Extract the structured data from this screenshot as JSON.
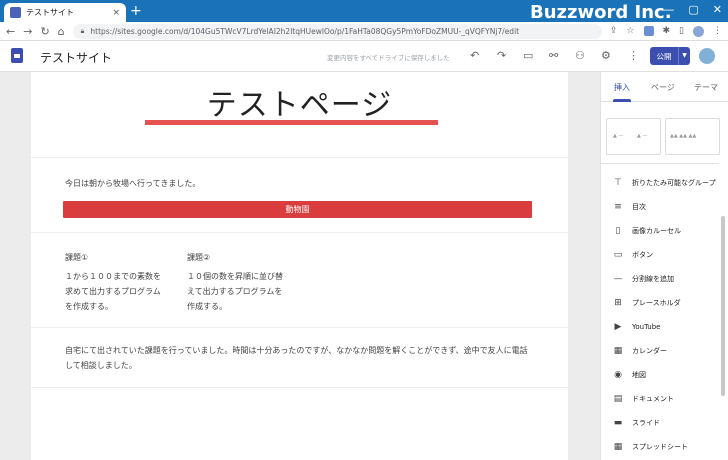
{
  "browser": {
    "tab_title": "テストサイト",
    "tab_close": "×",
    "new_tab": "+",
    "url": "https://sites.google.com/d/104Gu5TWcV7LrdYelAI2h2ltqHUewlOo/p/1FaHTa08QGy5PmYoFDoZMUU-_qVQFYNj7/edit",
    "window_controls": [
      "—",
      "▢",
      "✕"
    ]
  },
  "watermark": "Buzzword Inc.",
  "sites": {
    "site_title": "テストサイト",
    "save_status": "変更内容をすべてドライブに保存しました",
    "publish_label": "公開"
  },
  "page": {
    "title": "テストページ",
    "paragraph1": "今日は朝から牧場へ行ってきました。",
    "button_label": "動物園",
    "col1_heading": "課題①",
    "col1_body": "１から１００までの素数を求めて出力するプログラムを作成する。",
    "col2_heading": "課題②",
    "col2_body": "１０個の数を昇順に並び替えて出力するプログラムを作成する。",
    "paragraph2": "自宅にて出されていた課題を行っていました。時間は十分あったのですが、なかなか問題を解くことができず、途中で友人に電話して相談しました。"
  },
  "panel": {
    "tabs": [
      "挿入",
      "ページ",
      "テーマ"
    ],
    "active_tab": 0,
    "items": [
      {
        "icon": "collapsible-group-icon",
        "glyph": "⊤",
        "label": "折りたたみ可能なグループ"
      },
      {
        "icon": "toc-icon",
        "glyph": "≡",
        "label": "目次"
      },
      {
        "icon": "carousel-icon",
        "glyph": "▯",
        "label": "画像カルーセル"
      },
      {
        "icon": "button-icon",
        "glyph": "▭",
        "label": "ボタン"
      },
      {
        "icon": "divider-icon",
        "glyph": "—",
        "label": "分割線を追加"
      },
      {
        "icon": "placeholder-icon",
        "glyph": "⊞",
        "label": "プレースホルダ"
      },
      {
        "icon": "youtube-icon",
        "glyph": "▶",
        "label": "YouTube"
      },
      {
        "icon": "calendar-icon",
        "glyph": "▦",
        "label": "カレンダー"
      },
      {
        "icon": "map-pin-icon",
        "glyph": "◉",
        "label": "地図"
      },
      {
        "icon": "document-icon",
        "glyph": "▤",
        "label": "ドキュメント"
      },
      {
        "icon": "slides-icon",
        "glyph": "▬",
        "label": "スライド"
      },
      {
        "icon": "sheets-icon",
        "glyph": "▦",
        "label": "スプレッドシート"
      }
    ]
  }
}
